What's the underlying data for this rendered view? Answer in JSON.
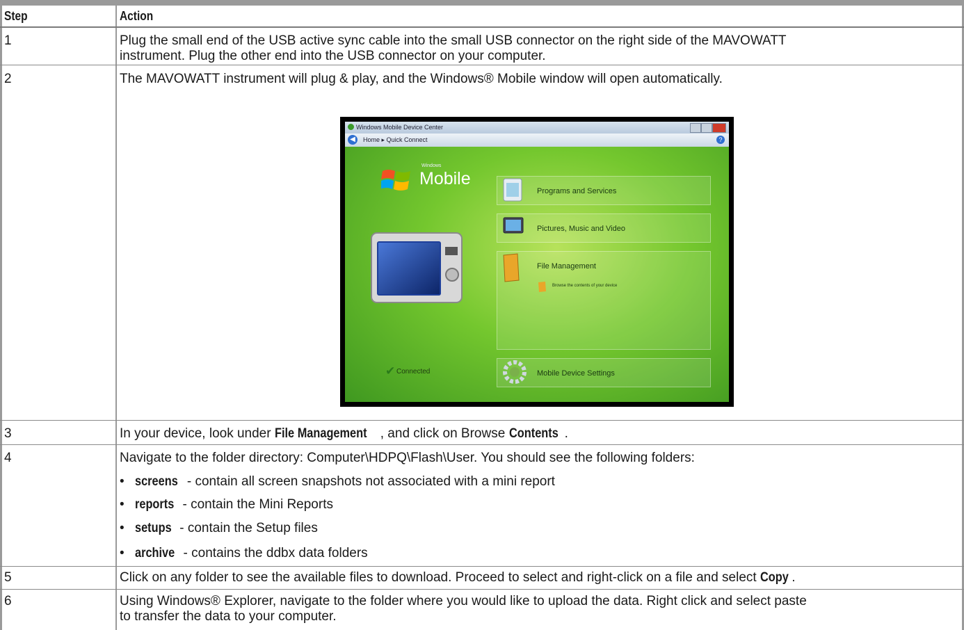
{
  "table": {
    "header": {
      "step": "Step",
      "action": "Action"
    },
    "rows": [
      {
        "step": "1",
        "line1": "Plug the small end of the USB active sync cable into the small USB connector on the right side of the MAVOWATT",
        "line2": "instrument. Plug the other end into the USB connector on your computer."
      },
      {
        "step": "2",
        "line1": "The MAVOWATT instrument will plug & play, and the Windows® Mobile window will open automatically."
      },
      {
        "step": "3",
        "pre": "In your device, look under ",
        "bold1": "File Management",
        "mid": ", and click on Browse ",
        "bold2": "Contents",
        "post": "."
      },
      {
        "step": "4",
        "line1": "Navigate to the folder directory: Computer\\HDPQ\\Flash\\User. You should see the following folders:",
        "bullets": [
          {
            "term": "screens",
            "desc": " - contain all screen snapshots not associated with a mini report"
          },
          {
            "term": "reports",
            "desc": " - contain the Mini Reports"
          },
          {
            "term": "setups",
            "desc": " - contain the Setup files"
          },
          {
            "term": "archive",
            "desc": " - contains the ddbx data folders"
          }
        ]
      },
      {
        "step": "5",
        "pre": "Click on any folder to see the available files to download. Proceed to select and right-click on a file and select ",
        "bold1": "Copy",
        "post": "."
      },
      {
        "step": "6",
        "line1": "Using Windows® Explorer, navigate to the folder where you would like to upload the data. Right click and select paste",
        "line2": "to transfer the data to your computer."
      }
    ]
  },
  "screenshot": {
    "title": "Windows Mobile Device Center",
    "breadcrumb": "Home ▸ Quick Connect",
    "brand_small": "Windows",
    "brand": "Mobile",
    "status": "Connected",
    "items": [
      {
        "label": "Programs and Services",
        "icon": "programs-icon"
      },
      {
        "label": "Pictures, Music and Video",
        "icon": "media-icon"
      },
      {
        "label": "File Management",
        "icon": "folder-icon"
      },
      {
        "label": "Browse the contents of your device",
        "icon": "browse-icon"
      },
      {
        "label": "Mobile Device Settings",
        "icon": "settings-gear-icon"
      }
    ]
  },
  "colors": {
    "grid": "#9a9a9a",
    "bg": "#ffffff",
    "text": "#1a1a1a",
    "screen_green": "#74c72e"
  }
}
